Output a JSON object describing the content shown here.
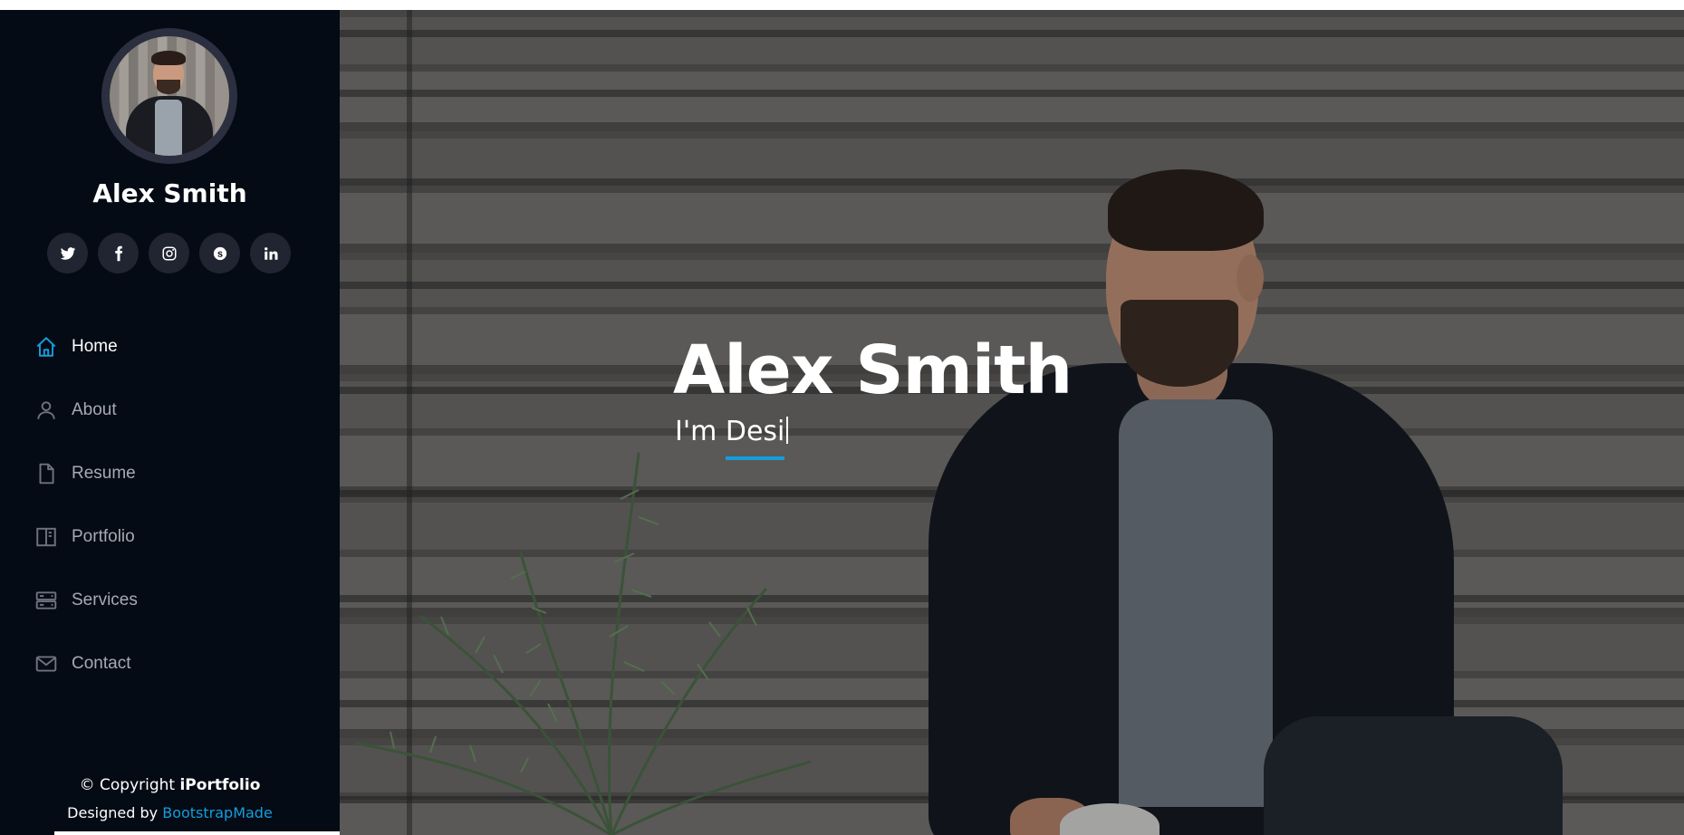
{
  "sidebar": {
    "profile_name": "Alex Smith",
    "social": [
      {
        "icon": "twitter-icon"
      },
      {
        "icon": "facebook-icon"
      },
      {
        "icon": "instagram-icon"
      },
      {
        "icon": "skype-icon"
      },
      {
        "icon": "linkedin-icon"
      }
    ],
    "nav": [
      {
        "label": "Home",
        "icon": "home-icon",
        "active": true
      },
      {
        "label": "About",
        "icon": "person-icon",
        "active": false
      },
      {
        "label": "Resume",
        "icon": "file-icon",
        "active": false
      },
      {
        "label": "Portfolio",
        "icon": "book-icon",
        "active": false
      },
      {
        "label": "Services",
        "icon": "server-icon",
        "active": false
      },
      {
        "label": "Contact",
        "icon": "envelope-icon",
        "active": false
      }
    ],
    "copyright_prefix": "© Copyright ",
    "copyright_brand": "iPortfolio",
    "designed_prefix": "Designed by ",
    "designed_link": "BootstrapMade"
  },
  "hero": {
    "title": "Alex Smith",
    "subtitle_static": "I'm ",
    "subtitle_typed": "Desi"
  },
  "colors": {
    "sidebar_bg": "#040b14",
    "accent": "#149ddd",
    "social_bg": "#212431",
    "nav_text": "#a8a9b4"
  }
}
